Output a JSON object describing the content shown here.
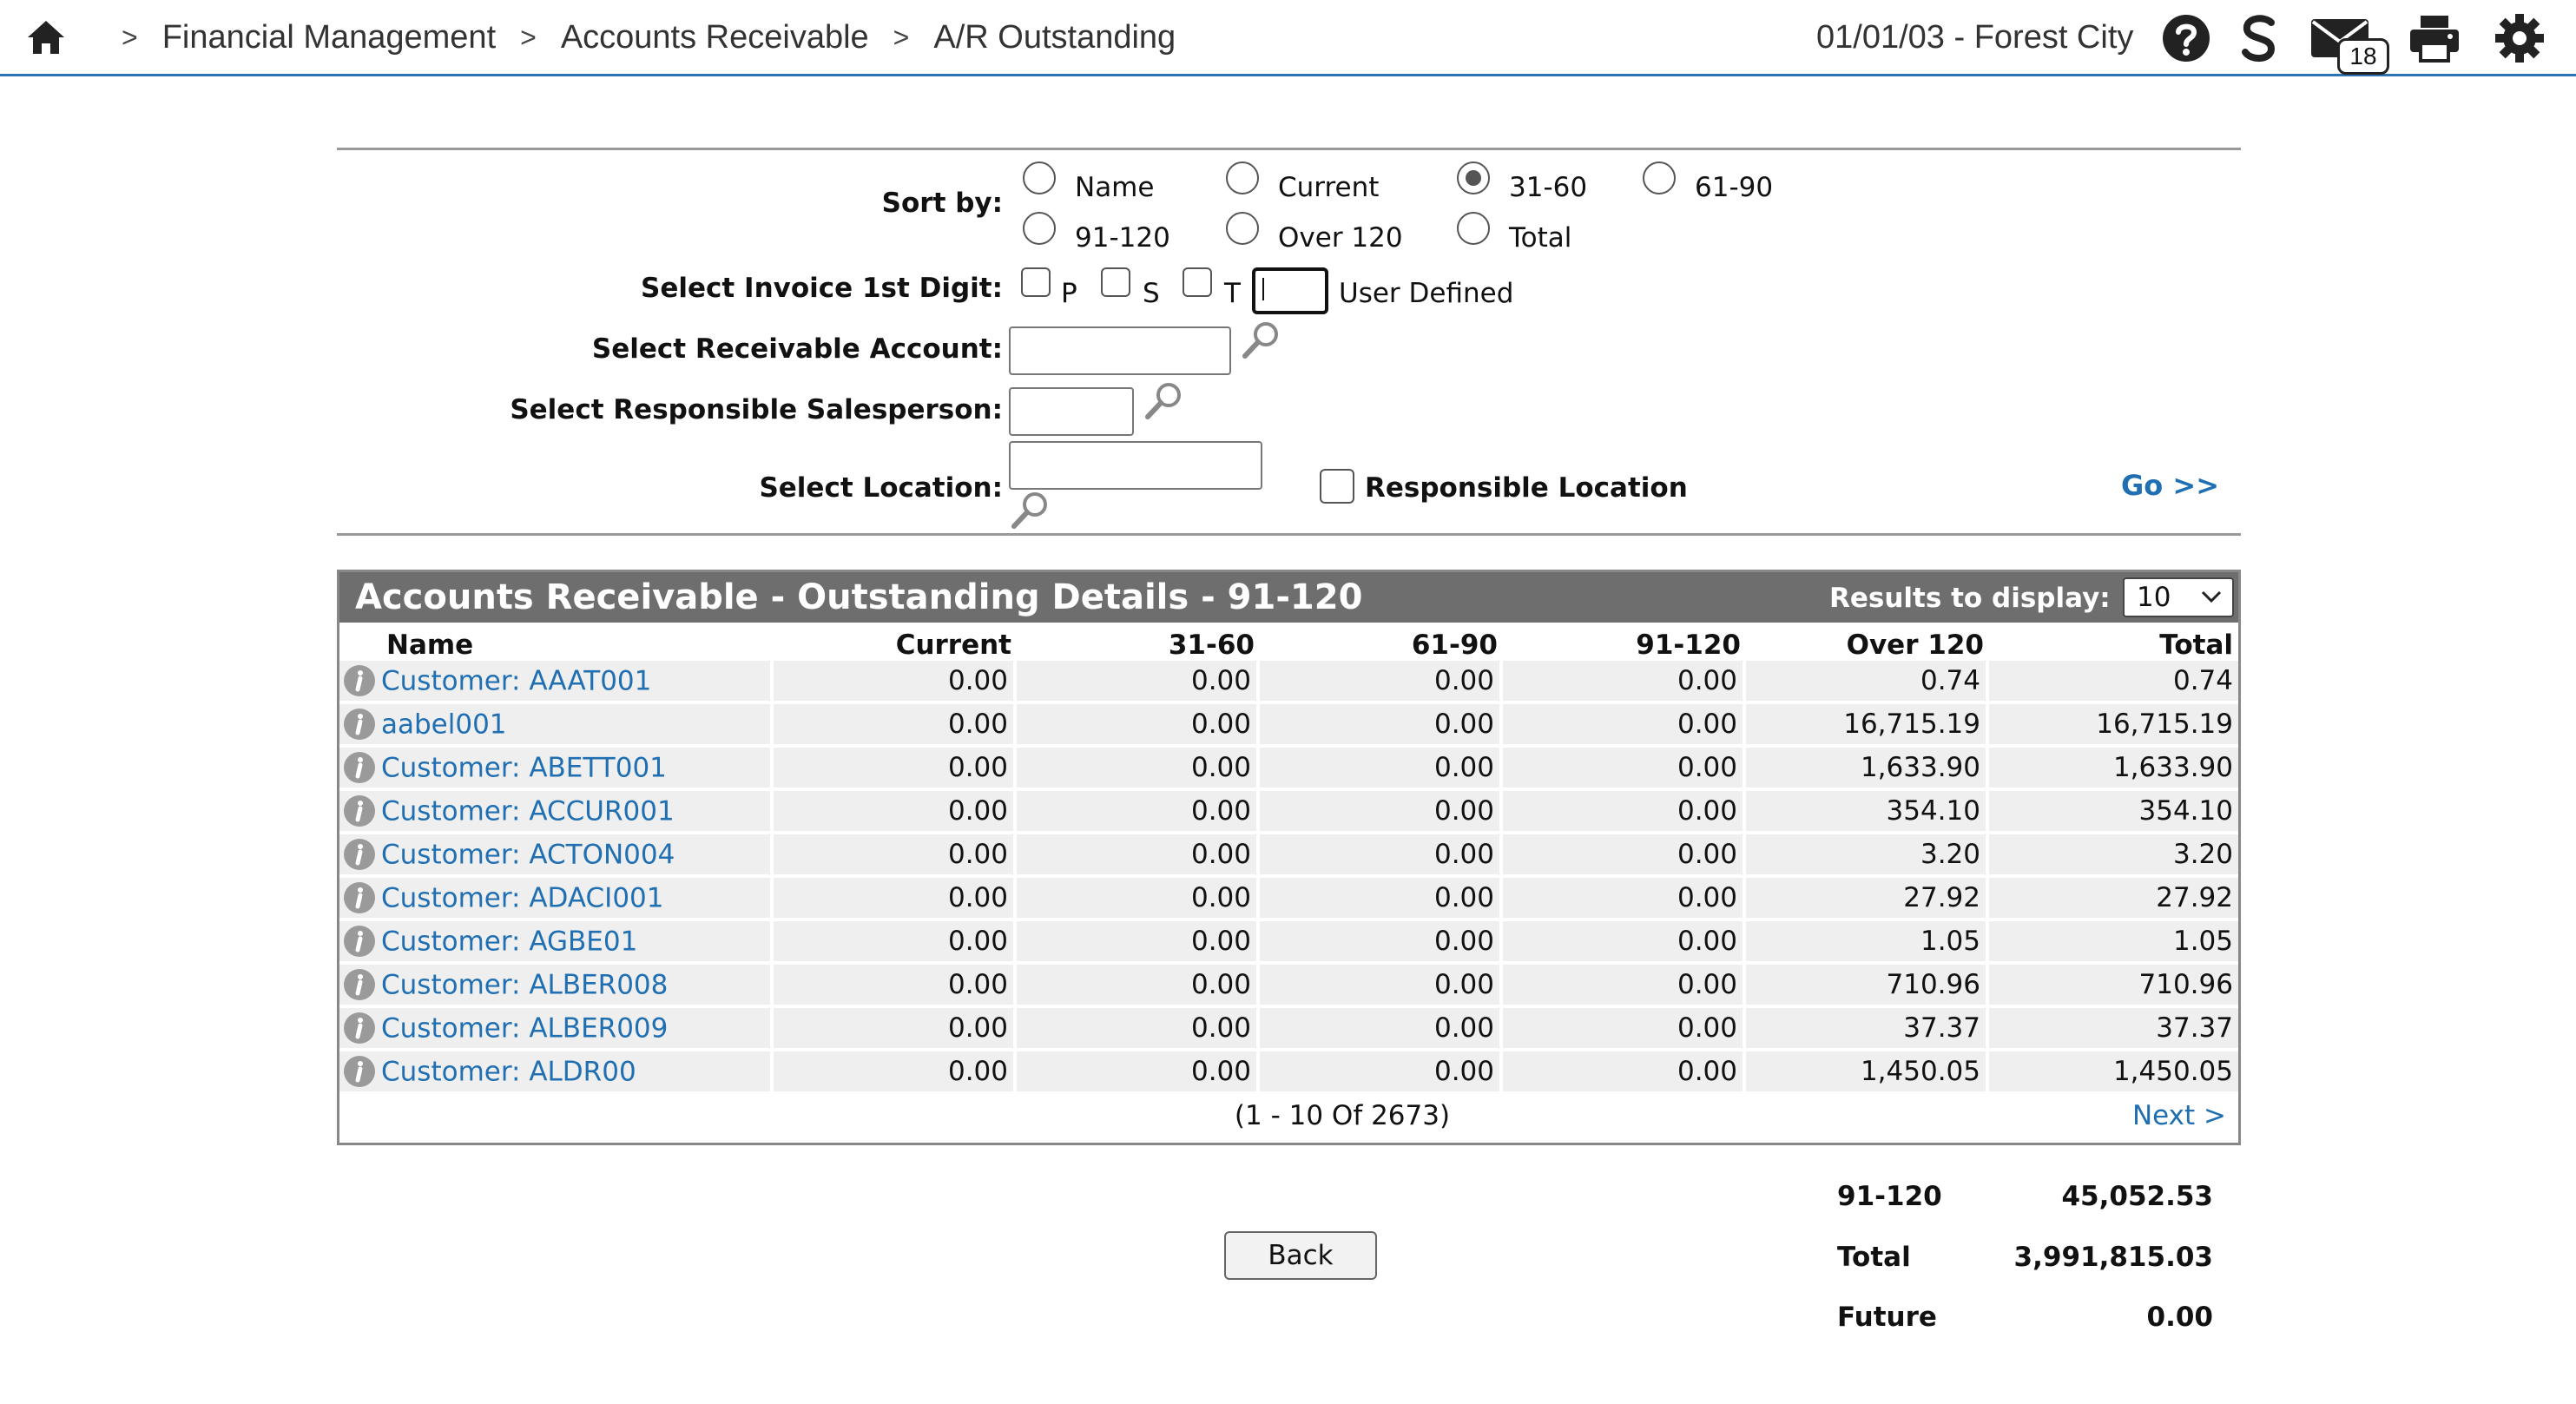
{
  "header": {
    "breadcrumbs": [
      "Financial Management",
      "Accounts Receivable",
      "A/R Outstanding"
    ],
    "separator": ">",
    "date_location": "01/01/03 - Forest City",
    "mail_count": "18",
    "icons": [
      "home-icon",
      "help-icon",
      "s-icon",
      "mail-icon",
      "print-icon",
      "gear-icon"
    ]
  },
  "filters": {
    "sort_by_label": "Sort by:",
    "sort_options": [
      "Name",
      "Current",
      "31-60",
      "61-90",
      "91-120",
      "Over 120",
      "Total"
    ],
    "sort_selected": "31-60",
    "invoice_digit_label": "Select Invoice 1st Digit:",
    "invoice_digits": [
      "P",
      "S",
      "T"
    ],
    "user_defined_label": "User Defined",
    "user_defined_value": "",
    "receivable_account_label": "Select Receivable Account:",
    "receivable_account_value": "",
    "salesperson_label": "Select Responsible Salesperson:",
    "salesperson_value": "",
    "location_label": "Select Location:",
    "location_value": "",
    "responsible_location_label": "Responsible Location",
    "go_label": "Go >>"
  },
  "results": {
    "title": "Accounts Receivable - Outstanding Details - 91-120",
    "results_to_display_label": "Results to display:",
    "results_to_display_value": "10",
    "columns": [
      "Name",
      "Current",
      "31-60",
      "61-90",
      "91-120",
      "Over 120",
      "Total"
    ],
    "rows": [
      {
        "name": "Customer: AAAT001",
        "current": "0.00",
        "d31_60": "0.00",
        "d61_90": "0.00",
        "d91_120": "0.00",
        "over120": "0.74",
        "total": "0.74"
      },
      {
        "name": "aabel001",
        "current": "0.00",
        "d31_60": "0.00",
        "d61_90": "0.00",
        "d91_120": "0.00",
        "over120": "16,715.19",
        "total": "16,715.19"
      },
      {
        "name": "Customer: ABETT001",
        "current": "0.00",
        "d31_60": "0.00",
        "d61_90": "0.00",
        "d91_120": "0.00",
        "over120": "1,633.90",
        "total": "1,633.90"
      },
      {
        "name": "Customer: ACCUR001",
        "current": "0.00",
        "d31_60": "0.00",
        "d61_90": "0.00",
        "d91_120": "0.00",
        "over120": "354.10",
        "total": "354.10"
      },
      {
        "name": "Customer: ACTON004",
        "current": "0.00",
        "d31_60": "0.00",
        "d61_90": "0.00",
        "d91_120": "0.00",
        "over120": "3.20",
        "total": "3.20"
      },
      {
        "name": "Customer: ADACI001",
        "current": "0.00",
        "d31_60": "0.00",
        "d61_90": "0.00",
        "d91_120": "0.00",
        "over120": "27.92",
        "total": "27.92"
      },
      {
        "name": "Customer: AGBE01",
        "current": "0.00",
        "d31_60": "0.00",
        "d61_90": "0.00",
        "d91_120": "0.00",
        "over120": "1.05",
        "total": "1.05"
      },
      {
        "name": "Customer: ALBER008",
        "current": "0.00",
        "d31_60": "0.00",
        "d61_90": "0.00",
        "d91_120": "0.00",
        "over120": "710.96",
        "total": "710.96"
      },
      {
        "name": "Customer: ALBER009",
        "current": "0.00",
        "d31_60": "0.00",
        "d61_90": "0.00",
        "d91_120": "0.00",
        "over120": "37.37",
        "total": "37.37"
      },
      {
        "name": "Customer: ALDR00",
        "current": "0.00",
        "d31_60": "0.00",
        "d61_90": "0.00",
        "d91_120": "0.00",
        "over120": "1,450.05",
        "total": "1,450.05"
      }
    ],
    "pager_text": "(1  -  10  Of  2673)",
    "next_label": "Next >"
  },
  "summary": [
    {
      "label": "91-120",
      "value": "45,052.53"
    },
    {
      "label": "Total",
      "value": "3,991,815.03"
    },
    {
      "label": "Future",
      "value": "0.00"
    }
  ],
  "back_label": "Back",
  "colors": {
    "accent_link": "#1f6fb2",
    "header_rule": "#2e74b5",
    "panel_header": "#6e6e6e",
    "row_bg": "#efefef"
  }
}
